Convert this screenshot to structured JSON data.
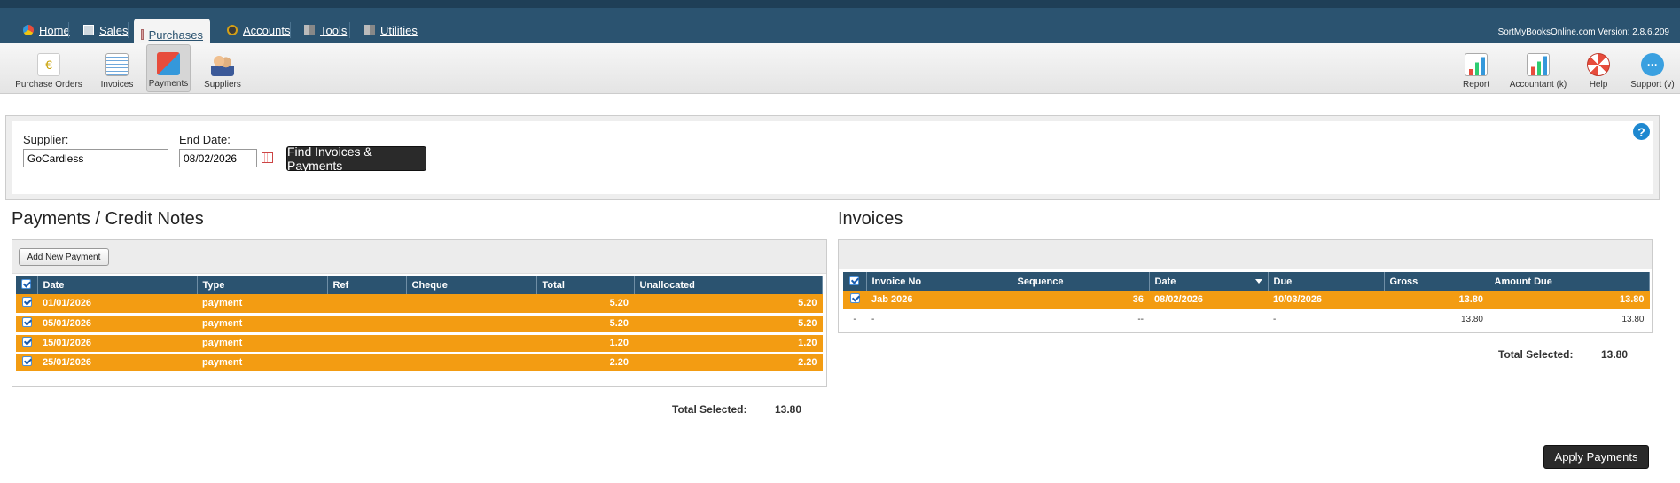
{
  "nav": {
    "tabs": [
      {
        "label": "Home",
        "icon": "home-icon"
      },
      {
        "label": "Sales",
        "icon": "sales-icon"
      },
      {
        "label": "Purchases",
        "icon": "purchases-icon",
        "active": true
      },
      {
        "label": "Accounts",
        "icon": "accounts-icon"
      },
      {
        "label": "Tools",
        "icon": "tools-icon"
      },
      {
        "label": "Utilities",
        "icon": "utilities-icon"
      }
    ],
    "version": "SortMyBooksOnline.com Version: 2.8.6.209"
  },
  "toolbar": {
    "left": [
      {
        "label": "Purchase Orders",
        "icon": "purchase-orders-icon"
      },
      {
        "label": "Invoices",
        "icon": "invoices-icon"
      },
      {
        "label": "Payments",
        "icon": "payments-icon",
        "active": true
      },
      {
        "label": "Suppliers",
        "icon": "suppliers-icon"
      }
    ],
    "right": [
      {
        "label": "Report",
        "icon": "report-icon"
      },
      {
        "label": "Accountant (k)",
        "icon": "accountant-icon"
      },
      {
        "label": "Help",
        "icon": "lifebuoy-icon"
      },
      {
        "label": "Support (v)",
        "icon": "chat-bubble-icon"
      }
    ]
  },
  "filter": {
    "supplier_label": "Supplier:",
    "supplier_value": "GoCardless",
    "end_date_label": "End Date:",
    "end_date_value": "08/02/2026",
    "find_button": "Find Invoices & Payments",
    "help_glyph": "?"
  },
  "payments": {
    "title": "Payments / Credit Notes",
    "add_button": "Add New Payment",
    "columns": [
      "Date",
      "Type",
      "Ref",
      "Cheque",
      "Total",
      "Unallocated"
    ],
    "rows": [
      {
        "date": "01/01/2026",
        "type": "payment",
        "ref": "",
        "cheque": "",
        "total": "5.20",
        "unallocated": "5.20"
      },
      {
        "date": "05/01/2026",
        "type": "payment",
        "ref": "",
        "cheque": "",
        "total": "5.20",
        "unallocated": "5.20"
      },
      {
        "date": "15/01/2026",
        "type": "payment",
        "ref": "",
        "cheque": "",
        "total": "1.20",
        "unallocated": "1.20"
      },
      {
        "date": "25/01/2026",
        "type": "payment",
        "ref": "",
        "cheque": "",
        "total": "2.20",
        "unallocated": "2.20"
      }
    ],
    "total_label": "Total Selected:",
    "total_value": "13.80"
  },
  "invoices": {
    "title": "Invoices",
    "columns": [
      "Invoice No",
      "Sequence",
      "Date",
      "Due",
      "Gross",
      "Amount Due"
    ],
    "rows": [
      {
        "invoice_no": "Jab 2026",
        "sequence": "36",
        "date": "08/02/2026",
        "due": "10/03/2026",
        "gross": "13.80",
        "amount_due": "13.80"
      }
    ],
    "summary": {
      "c0": "-",
      "c1": "-",
      "c2": "--",
      "c3": "-",
      "gross": "13.80",
      "amount_due": "13.80"
    },
    "total_label": "Total Selected:",
    "total_value": "13.80"
  },
  "apply_button": "Apply Payments",
  "colors": {
    "nav": "#2b5370",
    "row": "#f39c12",
    "button": "#2a2a2a"
  }
}
